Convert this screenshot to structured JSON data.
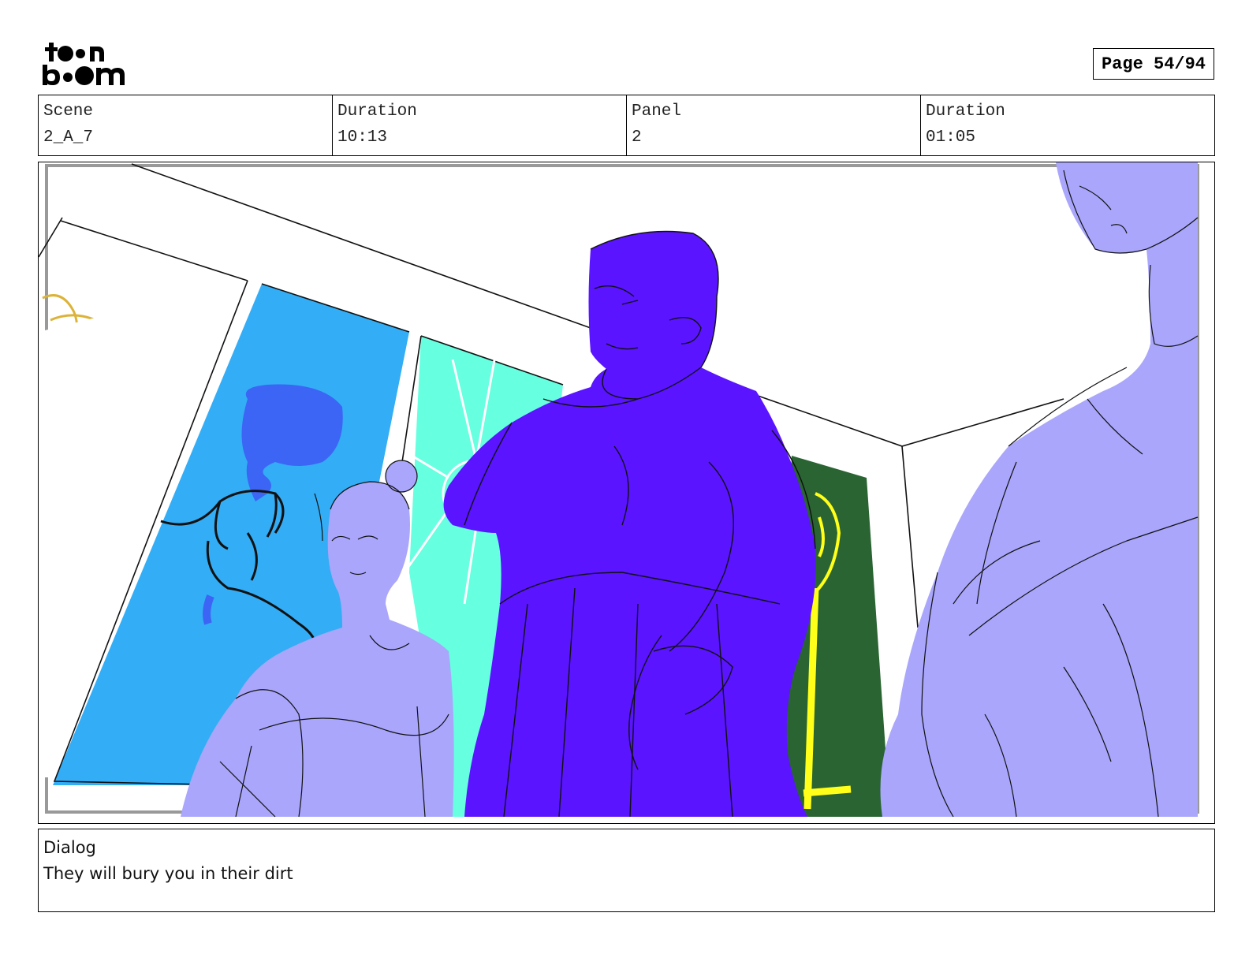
{
  "header": {
    "logo_text": "toon boom",
    "page_label": "Page 54/94"
  },
  "info": {
    "scene_label": "Scene",
    "scene_value": "2_A_7",
    "duration_label": "Duration",
    "duration_value": "10:13",
    "panel_label": "Panel",
    "panel_value": "2",
    "panel_duration_label": "Duration",
    "panel_duration_value": "01:05"
  },
  "dialog": {
    "label": "Dialog",
    "text": "They will bury you in their dirt"
  },
  "colors": {
    "blue_window": "#33adf5",
    "cyan_window": "#66ffe0",
    "green_window": "#2a6432",
    "purple_figure": "#5a14ff",
    "lavender_figure": "#a9a6fb",
    "gold_sketch": "#dcb338",
    "yellow_staff": "#ffff1a"
  }
}
